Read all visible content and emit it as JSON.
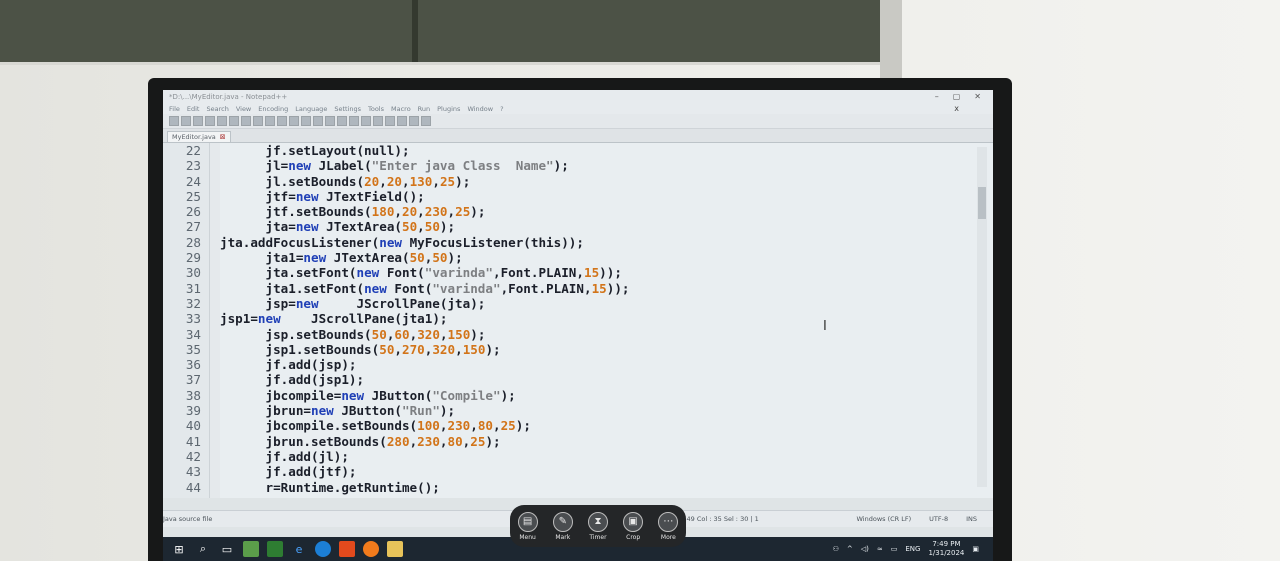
{
  "window": {
    "title": "*D:\\...\\MyEditor.java - Notepad++",
    "controls": [
      "–",
      "▢",
      "✕"
    ],
    "menu": [
      "File",
      "Edit",
      "Search",
      "View",
      "Encoding",
      "Language",
      "Settings",
      "Tools",
      "Macro",
      "Run",
      "Plugins",
      "Window",
      "?"
    ],
    "close_x": "x",
    "tab": "MyEditor.java"
  },
  "code": {
    "line_numbers": [
      "22",
      "23",
      "24",
      "25",
      "26",
      "27",
      "28",
      "29",
      "30",
      "31",
      "32",
      "33",
      "34",
      "35",
      "36",
      "37",
      "38",
      "39",
      "40",
      "41",
      "42",
      "43",
      "44"
    ],
    "lines": [
      "      jf.setLayout(null);",
      "      jl=new JLabel(\"Enter java Class  Name\");",
      "      jl.setBounds(20,20,130,25);",
      "      jtf=new JTextField();",
      "      jtf.setBounds(180,20,230,25);",
      "      jta=new JTextArea(50,50);",
      "jta.addFocusListener(new MyFocusListener(this));",
      "      jta1=new JTextArea(50,50);",
      "      jta.setFont(new Font(\"varinda\",Font.PLAIN,15));",
      "      jta1.setFont(new Font(\"varinda\",Font.PLAIN,15));",
      "      jsp=new     JScrollPane(jta);",
      "jsp1=new    JScrollPane(jta1);",
      "      jsp.setBounds(50,60,320,150);",
      "      jsp1.setBounds(50,270,320,150);",
      "      jf.add(jsp);",
      "      jf.add(jsp1);",
      "      jbcompile=new JButton(\"Compile\");",
      "      jbrun=new JButton(\"Run\");",
      "      jbcompile.setBounds(100,230,80,25);",
      "      jbrun.setBounds(280,230,80,25);",
      "      jf.add(jl);",
      "      jf.add(jtf);",
      "      r=Runtime.getRuntime();"
    ]
  },
  "status": {
    "file_type": "Java source file",
    "position": "149   Col : 35   Sel : 30 | 1",
    "eol": "Windows (CR LF)",
    "encoding": "UTF-8",
    "mode": "INS"
  },
  "float_toolbar": {
    "items": [
      {
        "label": "Menu",
        "icon": "▤"
      },
      {
        "label": "Mark",
        "icon": "✎"
      },
      {
        "label": "Timer",
        "icon": "⧗"
      },
      {
        "label": "Crop",
        "icon": "▣"
      },
      {
        "label": "More",
        "icon": "⋯"
      }
    ]
  },
  "taskbar": {
    "apps": [
      "windows-icon",
      "search-icon",
      "task-view-icon",
      "app-green-icon",
      "app-green2-icon",
      "edge-old-icon",
      "edge-icon",
      "brave-icon",
      "firefox-icon",
      "file-explorer-icon"
    ],
    "lang": "ENG",
    "time": "7:49 PM",
    "date": "1/31/2024"
  },
  "colors": {
    "keyword": "#1f3fb6",
    "number": "#d27419",
    "string": "#7d7f82"
  }
}
